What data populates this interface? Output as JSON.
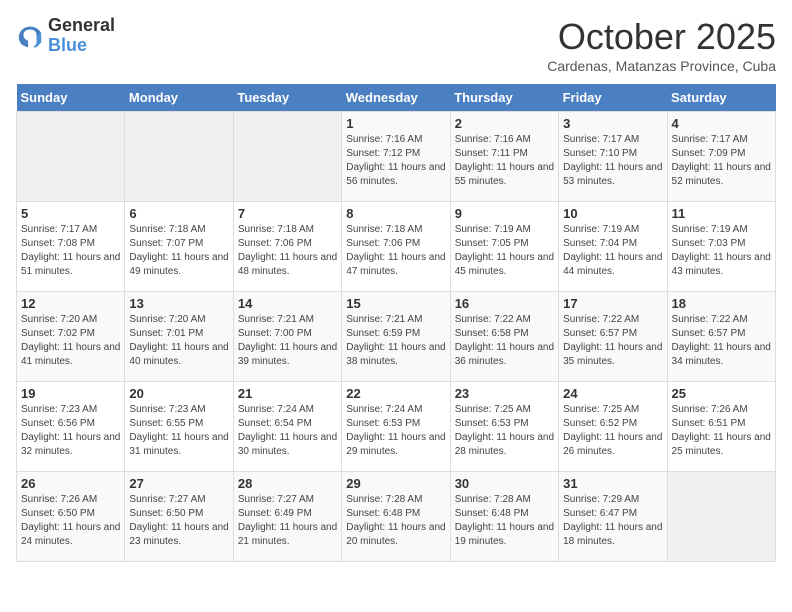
{
  "header": {
    "logo_general": "General",
    "logo_blue": "Blue",
    "title": "October 2025",
    "subtitle": "Cardenas, Matanzas Province, Cuba"
  },
  "days_of_week": [
    "Sunday",
    "Monday",
    "Tuesday",
    "Wednesday",
    "Thursday",
    "Friday",
    "Saturday"
  ],
  "weeks": [
    [
      {
        "day": "",
        "info": ""
      },
      {
        "day": "",
        "info": ""
      },
      {
        "day": "",
        "info": ""
      },
      {
        "day": "1",
        "info": "Sunrise: 7:16 AM\nSunset: 7:12 PM\nDaylight: 11 hours and 56 minutes."
      },
      {
        "day": "2",
        "info": "Sunrise: 7:16 AM\nSunset: 7:11 PM\nDaylight: 11 hours and 55 minutes."
      },
      {
        "day": "3",
        "info": "Sunrise: 7:17 AM\nSunset: 7:10 PM\nDaylight: 11 hours and 53 minutes."
      },
      {
        "day": "4",
        "info": "Sunrise: 7:17 AM\nSunset: 7:09 PM\nDaylight: 11 hours and 52 minutes."
      }
    ],
    [
      {
        "day": "5",
        "info": "Sunrise: 7:17 AM\nSunset: 7:08 PM\nDaylight: 11 hours and 51 minutes."
      },
      {
        "day": "6",
        "info": "Sunrise: 7:18 AM\nSunset: 7:07 PM\nDaylight: 11 hours and 49 minutes."
      },
      {
        "day": "7",
        "info": "Sunrise: 7:18 AM\nSunset: 7:06 PM\nDaylight: 11 hours and 48 minutes."
      },
      {
        "day": "8",
        "info": "Sunrise: 7:18 AM\nSunset: 7:06 PM\nDaylight: 11 hours and 47 minutes."
      },
      {
        "day": "9",
        "info": "Sunrise: 7:19 AM\nSunset: 7:05 PM\nDaylight: 11 hours and 45 minutes."
      },
      {
        "day": "10",
        "info": "Sunrise: 7:19 AM\nSunset: 7:04 PM\nDaylight: 11 hours and 44 minutes."
      },
      {
        "day": "11",
        "info": "Sunrise: 7:19 AM\nSunset: 7:03 PM\nDaylight: 11 hours and 43 minutes."
      }
    ],
    [
      {
        "day": "12",
        "info": "Sunrise: 7:20 AM\nSunset: 7:02 PM\nDaylight: 11 hours and 41 minutes."
      },
      {
        "day": "13",
        "info": "Sunrise: 7:20 AM\nSunset: 7:01 PM\nDaylight: 11 hours and 40 minutes."
      },
      {
        "day": "14",
        "info": "Sunrise: 7:21 AM\nSunset: 7:00 PM\nDaylight: 11 hours and 39 minutes."
      },
      {
        "day": "15",
        "info": "Sunrise: 7:21 AM\nSunset: 6:59 PM\nDaylight: 11 hours and 38 minutes."
      },
      {
        "day": "16",
        "info": "Sunrise: 7:22 AM\nSunset: 6:58 PM\nDaylight: 11 hours and 36 minutes."
      },
      {
        "day": "17",
        "info": "Sunrise: 7:22 AM\nSunset: 6:57 PM\nDaylight: 11 hours and 35 minutes."
      },
      {
        "day": "18",
        "info": "Sunrise: 7:22 AM\nSunset: 6:57 PM\nDaylight: 11 hours and 34 minutes."
      }
    ],
    [
      {
        "day": "19",
        "info": "Sunrise: 7:23 AM\nSunset: 6:56 PM\nDaylight: 11 hours and 32 minutes."
      },
      {
        "day": "20",
        "info": "Sunrise: 7:23 AM\nSunset: 6:55 PM\nDaylight: 11 hours and 31 minutes."
      },
      {
        "day": "21",
        "info": "Sunrise: 7:24 AM\nSunset: 6:54 PM\nDaylight: 11 hours and 30 minutes."
      },
      {
        "day": "22",
        "info": "Sunrise: 7:24 AM\nSunset: 6:53 PM\nDaylight: 11 hours and 29 minutes."
      },
      {
        "day": "23",
        "info": "Sunrise: 7:25 AM\nSunset: 6:53 PM\nDaylight: 11 hours and 28 minutes."
      },
      {
        "day": "24",
        "info": "Sunrise: 7:25 AM\nSunset: 6:52 PM\nDaylight: 11 hours and 26 minutes."
      },
      {
        "day": "25",
        "info": "Sunrise: 7:26 AM\nSunset: 6:51 PM\nDaylight: 11 hours and 25 minutes."
      }
    ],
    [
      {
        "day": "26",
        "info": "Sunrise: 7:26 AM\nSunset: 6:50 PM\nDaylight: 11 hours and 24 minutes."
      },
      {
        "day": "27",
        "info": "Sunrise: 7:27 AM\nSunset: 6:50 PM\nDaylight: 11 hours and 23 minutes."
      },
      {
        "day": "28",
        "info": "Sunrise: 7:27 AM\nSunset: 6:49 PM\nDaylight: 11 hours and 21 minutes."
      },
      {
        "day": "29",
        "info": "Sunrise: 7:28 AM\nSunset: 6:48 PM\nDaylight: 11 hours and 20 minutes."
      },
      {
        "day": "30",
        "info": "Sunrise: 7:28 AM\nSunset: 6:48 PM\nDaylight: 11 hours and 19 minutes."
      },
      {
        "day": "31",
        "info": "Sunrise: 7:29 AM\nSunset: 6:47 PM\nDaylight: 11 hours and 18 minutes."
      },
      {
        "day": "",
        "info": ""
      }
    ]
  ]
}
